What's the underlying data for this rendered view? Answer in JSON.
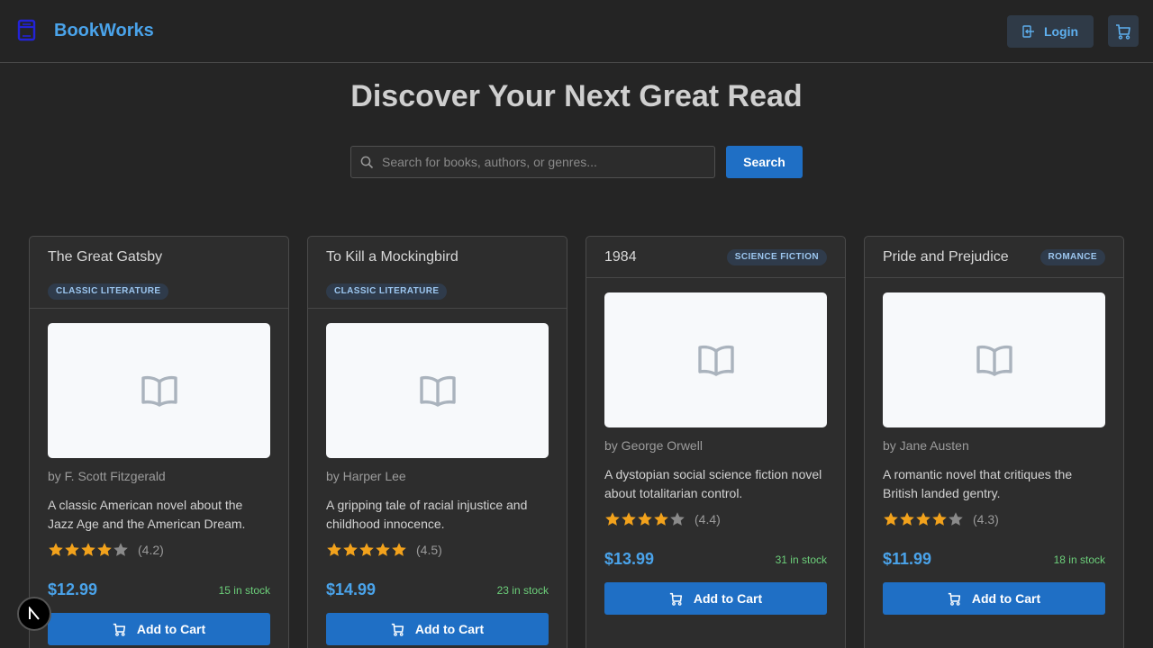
{
  "header": {
    "brand_name": "BookWorks",
    "login_label": "Login",
    "brand_icon": "book-icon",
    "cart_icon": "cart-icon"
  },
  "hero": {
    "title": "Discover Your Next Great Read"
  },
  "search": {
    "placeholder": "Search for books, authors, or genres...",
    "button_label": "Search"
  },
  "books": [
    {
      "title": "The Great Gatsby",
      "genre": "CLASSIC LITERATURE",
      "author": "by F. Scott Fitzgerald",
      "description": "A classic American novel about the Jazz Age and the American Dream.",
      "rating": 4.2,
      "rating_label": "(4.2)",
      "price": "$12.99",
      "stock": "15 in stock",
      "add_label": "Add to Cart"
    },
    {
      "title": "To Kill a Mockingbird",
      "genre": "CLASSIC LITERATURE",
      "author": "by Harper Lee",
      "description": "A gripping tale of racial injustice and childhood innocence.",
      "rating": 4.5,
      "rating_label": "(4.5)",
      "price": "$14.99",
      "stock": "23 in stock",
      "add_label": "Add to Cart"
    },
    {
      "title": "1984",
      "genre": "SCIENCE FICTION",
      "author": "by George Orwell",
      "description": "A dystopian social science fiction novel about totalitarian control.",
      "rating": 4.4,
      "rating_label": "(4.4)",
      "price": "$13.99",
      "stock": "31 in stock",
      "add_label": "Add to Cart"
    },
    {
      "title": "Pride and Prejudice",
      "genre": "ROMANCE",
      "author": "by Jane Austen",
      "description": "A romantic novel that critiques the British landed gentry.",
      "rating": 4.3,
      "rating_label": "(4.3)",
      "price": "$11.99",
      "stock": "18 in stock",
      "add_label": "Add to Cart"
    }
  ],
  "colors": {
    "accent": "#4aa3ea",
    "button": "#1f6fc5",
    "stock": "#6ccf7a",
    "star": "#f2a21c"
  }
}
